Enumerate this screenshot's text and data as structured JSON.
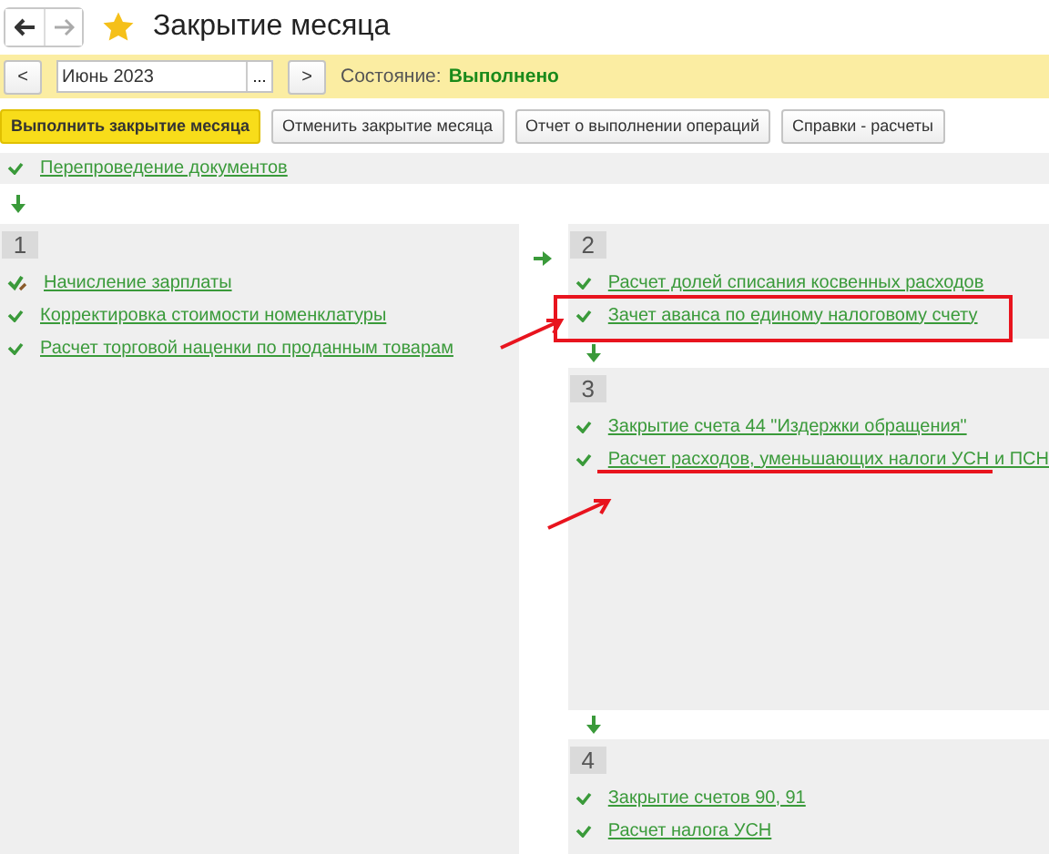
{
  "window": {
    "title": "Закрытие месяца"
  },
  "period": {
    "prev": "<",
    "value": "Июнь 2023",
    "choose": "...",
    "next": ">",
    "state_label": "Состояние:",
    "state_value": "Выполнено"
  },
  "buttons": [
    {
      "label": "Выполнить закрытие месяца",
      "kind": "primary"
    },
    {
      "label": "Отменить закрытие месяца",
      "kind": "normal"
    },
    {
      "label": "Отчет о выполнении операций",
      "kind": "normal"
    },
    {
      "label": "Справки - расчеты",
      "kind": "normal"
    }
  ],
  "pre_step": {
    "label": "Перепроведение документов",
    "done": true,
    "edited": false
  },
  "left_stages": [
    {
      "number": "1",
      "items": [
        {
          "label": "Начисление зарплаты",
          "done": true,
          "edited": true,
          "framed": false,
          "underlined": false
        },
        {
          "label": "Корректировка стоимости номенклатуры",
          "done": true,
          "edited": false,
          "framed": false,
          "underlined": false
        },
        {
          "label": "Расчет торговой наценки по проданным товарам",
          "done": true,
          "edited": false,
          "framed": false,
          "underlined": false
        }
      ]
    }
  ],
  "right_stages": [
    {
      "number": "2",
      "items": [
        {
          "label": "Расчет долей списания косвенных расходов",
          "done": true,
          "edited": false,
          "framed": false,
          "underlined": false
        },
        {
          "label": "Зачет аванса по единому налоговому счету",
          "done": true,
          "edited": false,
          "framed": true,
          "underlined": false
        }
      ]
    },
    {
      "number": "3",
      "items": [
        {
          "label": "Закрытие счета 44 \"Издержки обращения\"",
          "done": true,
          "edited": false,
          "framed": false,
          "underlined": false
        },
        {
          "label": "Расчет расходов, уменьшающих налоги УСН и ПСН",
          "done": true,
          "edited": false,
          "framed": false,
          "underlined": true
        }
      ]
    },
    {
      "number": "4",
      "items": [
        {
          "label": "Закрытие счетов 90, 91",
          "done": true,
          "edited": false,
          "framed": false,
          "underlined": false
        },
        {
          "label": "Расчет налога УСН",
          "done": true,
          "edited": false,
          "framed": false,
          "underlined": false
        }
      ]
    }
  ]
}
